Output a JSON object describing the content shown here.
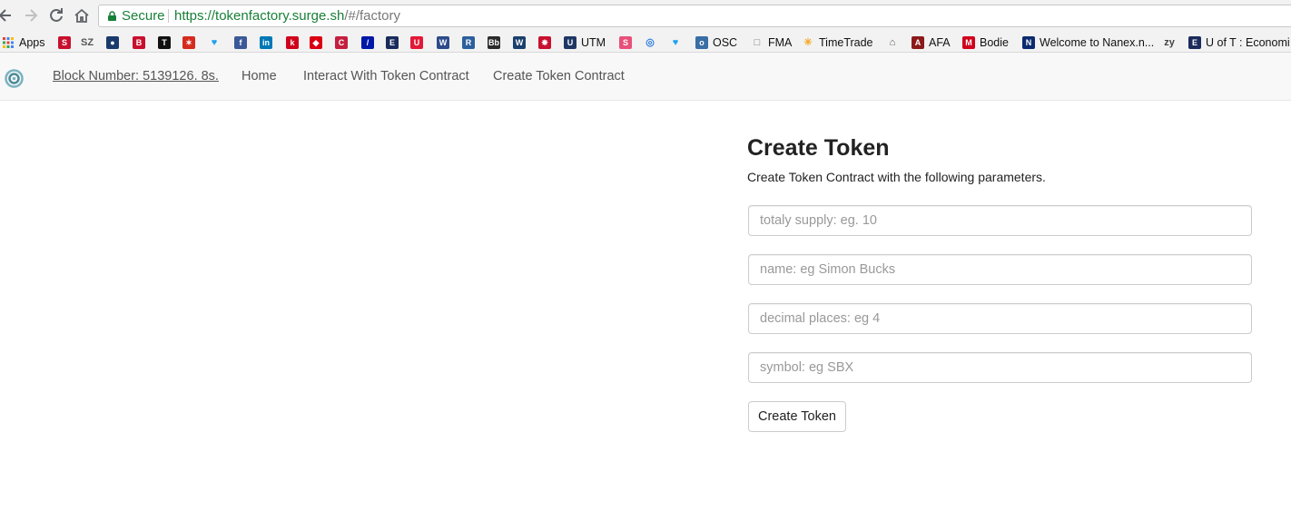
{
  "browser": {
    "secure_label": "Secure",
    "url_host": "https://tokenfactory.surge.sh",
    "url_path": "/#/factory"
  },
  "bookmarks": [
    {
      "label": "Apps",
      "icon": "apps-grid-icon",
      "color": "#e94235"
    },
    {
      "label": "",
      "icon": "s-icon",
      "color": "#c8102e"
    },
    {
      "label": "",
      "icon": "sz-icon",
      "color": "#555555"
    },
    {
      "label": "",
      "icon": "globe-icon",
      "color": "#1a3a6c"
    },
    {
      "label": "",
      "icon": "bill-icon",
      "color": "#c8102e"
    },
    {
      "label": "",
      "icon": "nyt-icon",
      "color": "#111111"
    },
    {
      "label": "",
      "icon": "maple-leaf-icon",
      "color": "#d52b1e"
    },
    {
      "label": "",
      "icon": "twitter-icon",
      "color": "#1da1f2"
    },
    {
      "label": "",
      "icon": "facebook-icon",
      "color": "#3b5998"
    },
    {
      "label": "",
      "icon": "linkedin-icon",
      "color": "#0077b5"
    },
    {
      "label": "",
      "icon": "k-icon",
      "color": "#d0021b"
    },
    {
      "label": "",
      "icon": "hsbc-icon",
      "color": "#db0011"
    },
    {
      "label": "",
      "icon": "cibc-icon",
      "color": "#c41f3e"
    },
    {
      "label": "",
      "icon": "deutsche-icon",
      "color": "#0018a8"
    },
    {
      "label": "",
      "icon": "e-icon",
      "color": "#1a2b5c"
    },
    {
      "label": "",
      "icon": "u-icon",
      "color": "#e31837"
    },
    {
      "label": "",
      "icon": "w-shield-icon",
      "color": "#2d4b8b"
    },
    {
      "label": "",
      "icon": "r-icon",
      "color": "#2c5f9e"
    },
    {
      "label": "",
      "icon": "bb-icon",
      "color": "#2a2a2a"
    },
    {
      "label": "",
      "icon": "w-icon",
      "color": "#1b3f6c"
    },
    {
      "label": "",
      "icon": "gear-red-icon",
      "color": "#c8102e"
    },
    {
      "label": "UTM",
      "icon": "utm-icon",
      "color": "#1e3765"
    },
    {
      "label": "",
      "icon": "s-pink-icon",
      "color": "#e8507a"
    },
    {
      "label": "",
      "icon": "target-icon",
      "color": "#2a7de1"
    },
    {
      "label": "",
      "icon": "twitter-icon",
      "color": "#1da1f2"
    },
    {
      "label": "OSC",
      "icon": "osc-icon",
      "color": "#3a6ea5"
    },
    {
      "label": "FMA",
      "icon": "page-icon",
      "color": "#777777"
    },
    {
      "label": "TimeTrade",
      "icon": "timetrade-icon",
      "color": "#f5a623"
    },
    {
      "label": "",
      "icon": "building-icon",
      "color": "#555555"
    },
    {
      "label": "AFA",
      "icon": "afa-icon",
      "color": "#8b1a1a"
    },
    {
      "label": "Bodie",
      "icon": "m-icon",
      "color": "#d0021b"
    },
    {
      "label": "Welcome to Nanex.n...",
      "icon": "n-icon",
      "color": "#0b2a6f"
    },
    {
      "label": "",
      "icon": "zy-icon",
      "color": "#444444"
    },
    {
      "label": "U of T : Economi",
      "icon": "e-icon",
      "color": "#1a2b5c"
    }
  ],
  "navbar": {
    "block_number": "Block Number: 5139126. 8s.",
    "home": "Home",
    "interact": "Interact With Token Contract",
    "create": "Create Token Contract"
  },
  "form": {
    "title": "Create Token",
    "subtitle": "Create Token Contract with the following parameters.",
    "supply_placeholder": "totaly supply: eg. 10",
    "name_placeholder": "name: eg Simon Bucks",
    "decimals_placeholder": "decimal places: eg 4",
    "symbol_placeholder": "symbol: eg SBX",
    "submit_label": "Create Token"
  }
}
